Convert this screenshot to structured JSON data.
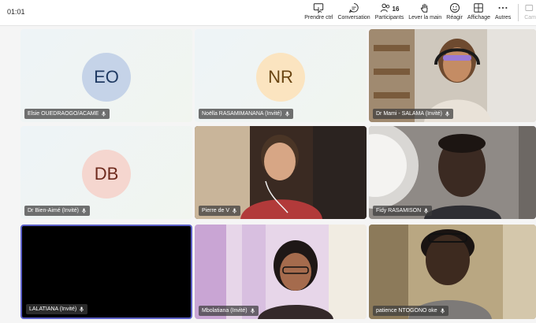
{
  "meeting": {
    "timer": "01:01"
  },
  "toolbar": {
    "take_control": "Prendre ctrl",
    "chat": "Conversation",
    "participants": "Participants",
    "participants_count": "16",
    "raise_hand": "Lever la main",
    "react": "Réagir",
    "view": "Affichage",
    "more": "Autres",
    "camera": "Cam"
  },
  "tiles": [
    {
      "name": "Elsie OUEDRAOGO/ACAME",
      "initials": "EO",
      "avatar_bg": "#c5d3e8",
      "avatar_fg": "#1f3a63"
    },
    {
      "name": "Noëlla RASAMIMANANA (Invité)",
      "initials": "NR",
      "avatar_bg": "#fbe4c0",
      "avatar_fg": "#6a4512"
    },
    {
      "name": "Dr Mami - SALAMA (Invité)"
    },
    {
      "name": "Dr Bien-Aimé (Invité)",
      "initials": "DB",
      "avatar_bg": "#f5d6cf",
      "avatar_fg": "#6e2a1d"
    },
    {
      "name": "Pierre de V"
    },
    {
      "name": "Fidy RASAMISON"
    },
    {
      "name": "LALATIANA (Invité)"
    },
    {
      "name": "Mbolatiana (Invité)"
    },
    {
      "name": "patience NTOGONO oke"
    }
  ],
  "colors": {
    "active_speaker_border": "#5b5fc7",
    "nametag_bg": "#3c3c3c"
  }
}
